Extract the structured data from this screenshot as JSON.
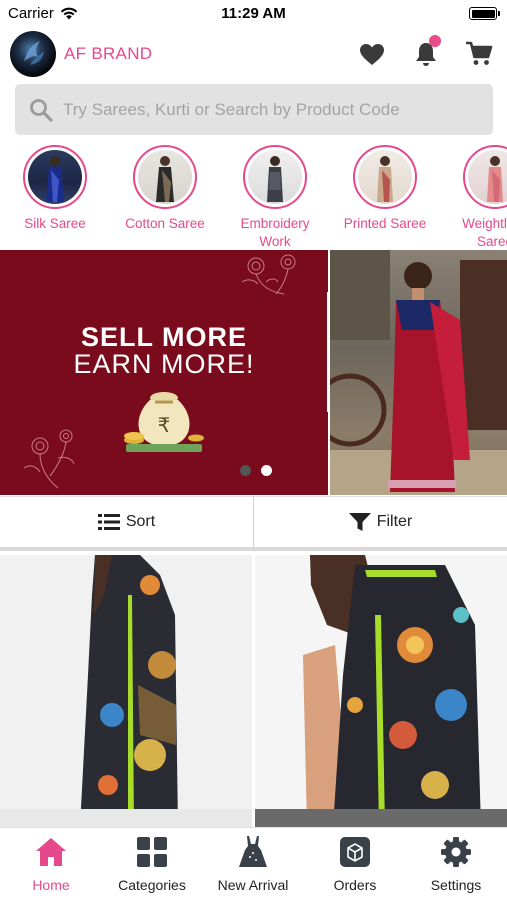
{
  "status_bar": {
    "carrier": "Carrier",
    "time": "11:29 AM"
  },
  "header": {
    "brand_name": "AF BRAND"
  },
  "search": {
    "placeholder": "Try Sarees, Kurti or Search by Product Code"
  },
  "categories": [
    {
      "label": "Silk Saree"
    },
    {
      "label": "Cotton Saree"
    },
    {
      "label": "Embroidery\nWork"
    },
    {
      "label": "Printed Saree"
    },
    {
      "label": "Weightless\nSaree"
    }
  ],
  "banner": {
    "line1": "SELL MORE",
    "line2": "EARN MORE!",
    "currency_symbol": "₹",
    "page_count": 2,
    "active_page": 2
  },
  "sort_filter": {
    "sort_label": "Sort",
    "filter_label": "Filter"
  },
  "bottom_nav": {
    "items": [
      {
        "label": "Home",
        "icon": "home-icon"
      },
      {
        "label": "Categories",
        "icon": "grid-icon"
      },
      {
        "label": "New Arrival",
        "icon": "dress-icon"
      },
      {
        "label": "Orders",
        "icon": "box-icon"
      },
      {
        "label": "Settings",
        "icon": "gear-icon"
      }
    ],
    "active": "Home"
  },
  "colors": {
    "accent": "#e6498b",
    "banner_bg": "#7a0b1c",
    "search_bg": "#e2e2e2",
    "icon_dark": "#3a3a3a"
  }
}
